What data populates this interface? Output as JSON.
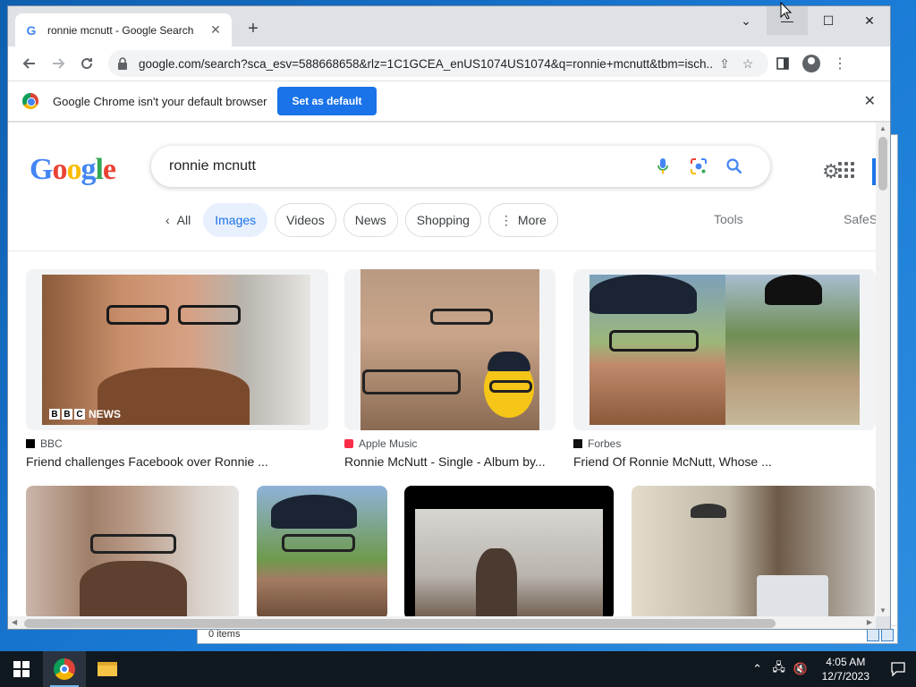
{
  "browser": {
    "tab_title": "ronnie mcnutt - Google Search",
    "url": "google.com/search?sca_esv=588668658&rlz=1C1GCEA_enUS1074US1074&q=ronnie+mcnutt&tbm=isch...",
    "infobar_text": "Google Chrome isn't your default browser",
    "infobar_button": "Set as default"
  },
  "search": {
    "logo_letters": [
      "G",
      "o",
      "o",
      "g",
      "l",
      "e"
    ],
    "query": "ronnie mcnutt",
    "filters": {
      "all": "All",
      "images": "Images",
      "videos": "Videos",
      "news": "News",
      "shopping": "Shopping",
      "more": "More"
    },
    "tools": "Tools",
    "safesearch": "SafeS"
  },
  "results": [
    {
      "source": "BBC",
      "caption": "Friend challenges Facebook over Ronnie ...",
      "badge": [
        "B",
        "B",
        "C"
      ],
      "badge_word": "NEWS"
    },
    {
      "source": "Apple Music",
      "caption": "Ronnie McNutt - Single - Album by..."
    },
    {
      "source": "Forbes",
      "caption": "Friend Of Ronnie McNutt, Whose ..."
    }
  ],
  "explorer": {
    "status": "0 items"
  },
  "taskbar": {
    "time": "4:05 AM",
    "date": "12/7/2023"
  },
  "colors": {
    "accent": "#1a73e8",
    "chip_active_bg": "#e8f0fe",
    "taskbar": "#101820"
  }
}
